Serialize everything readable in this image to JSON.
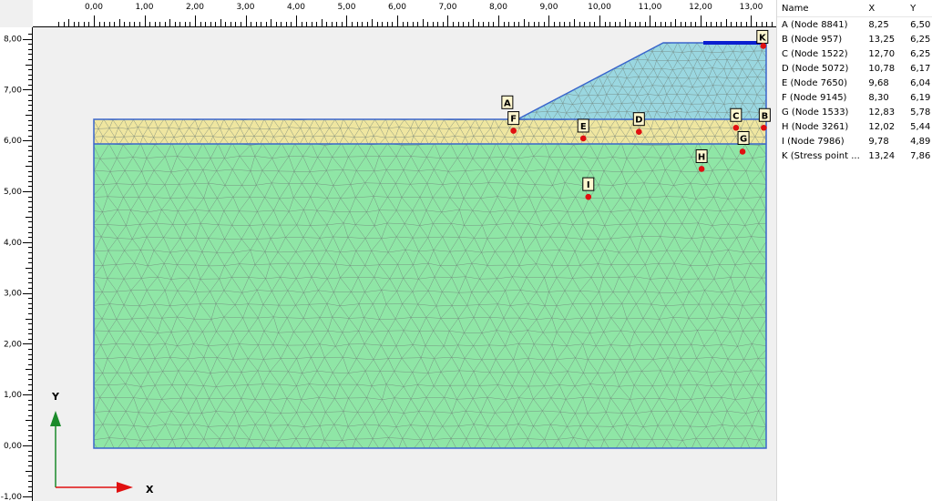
{
  "axes": {
    "x_ticks": [
      "0,00",
      "1,00",
      "2,00",
      "3,00",
      "4,00",
      "5,00",
      "6,00",
      "7,00",
      "8,00",
      "9,00",
      "10,00",
      "11,00",
      "12,00",
      "13,00"
    ],
    "y_ticks": [
      "8,00",
      "7,00",
      "6,00",
      "5,00",
      "4,00",
      "3,00",
      "2,00",
      "1,00",
      "0,00",
      "-1,00"
    ],
    "x_label": "X",
    "y_label": "Y"
  },
  "colors": {
    "canvas_bg": "#f0f0f0",
    "soil_main": "#8fe6a6",
    "soil_top": "#efe6a0",
    "embankment": "#9ad7e0",
    "outline": "#3a66cc",
    "mesh": "#6f7f78",
    "point": "#e01010",
    "load": "#0a1fd0",
    "axis_y_arrow": "#1a8a2a",
    "axis_x_arrow": "#e01010"
  },
  "points_table": {
    "headers": {
      "name": "Name",
      "x": "X",
      "y": "Y"
    },
    "rows": [
      {
        "label": "A",
        "name": "A (Node 8841)",
        "x": "8,25",
        "y": "6,50"
      },
      {
        "label": "B",
        "name": "B (Node 957)",
        "x": "13,25",
        "y": "6,25"
      },
      {
        "label": "C",
        "name": "C (Node 1522)",
        "x": "12,70",
        "y": "6,25"
      },
      {
        "label": "D",
        "name": "D (Node 5072)",
        "x": "10,78",
        "y": "6,17"
      },
      {
        "label": "E",
        "name": "E (Node 7650)",
        "x": "9,68",
        "y": "6,04"
      },
      {
        "label": "F",
        "name": "F (Node 9145)",
        "x": "8,30",
        "y": "6,19"
      },
      {
        "label": "G",
        "name": "G (Node 1533)",
        "x": "12,83",
        "y": "5,78"
      },
      {
        "label": "H",
        "name": "H (Node 3261)",
        "x": "12,02",
        "y": "5,44"
      },
      {
        "label": "I",
        "name": "I (Node 7986)",
        "x": "9,78",
        "y": "4,89"
      },
      {
        "label": "K",
        "name": "K (Stress point ...",
        "x": "13,24",
        "y": "7,86"
      }
    ]
  }
}
